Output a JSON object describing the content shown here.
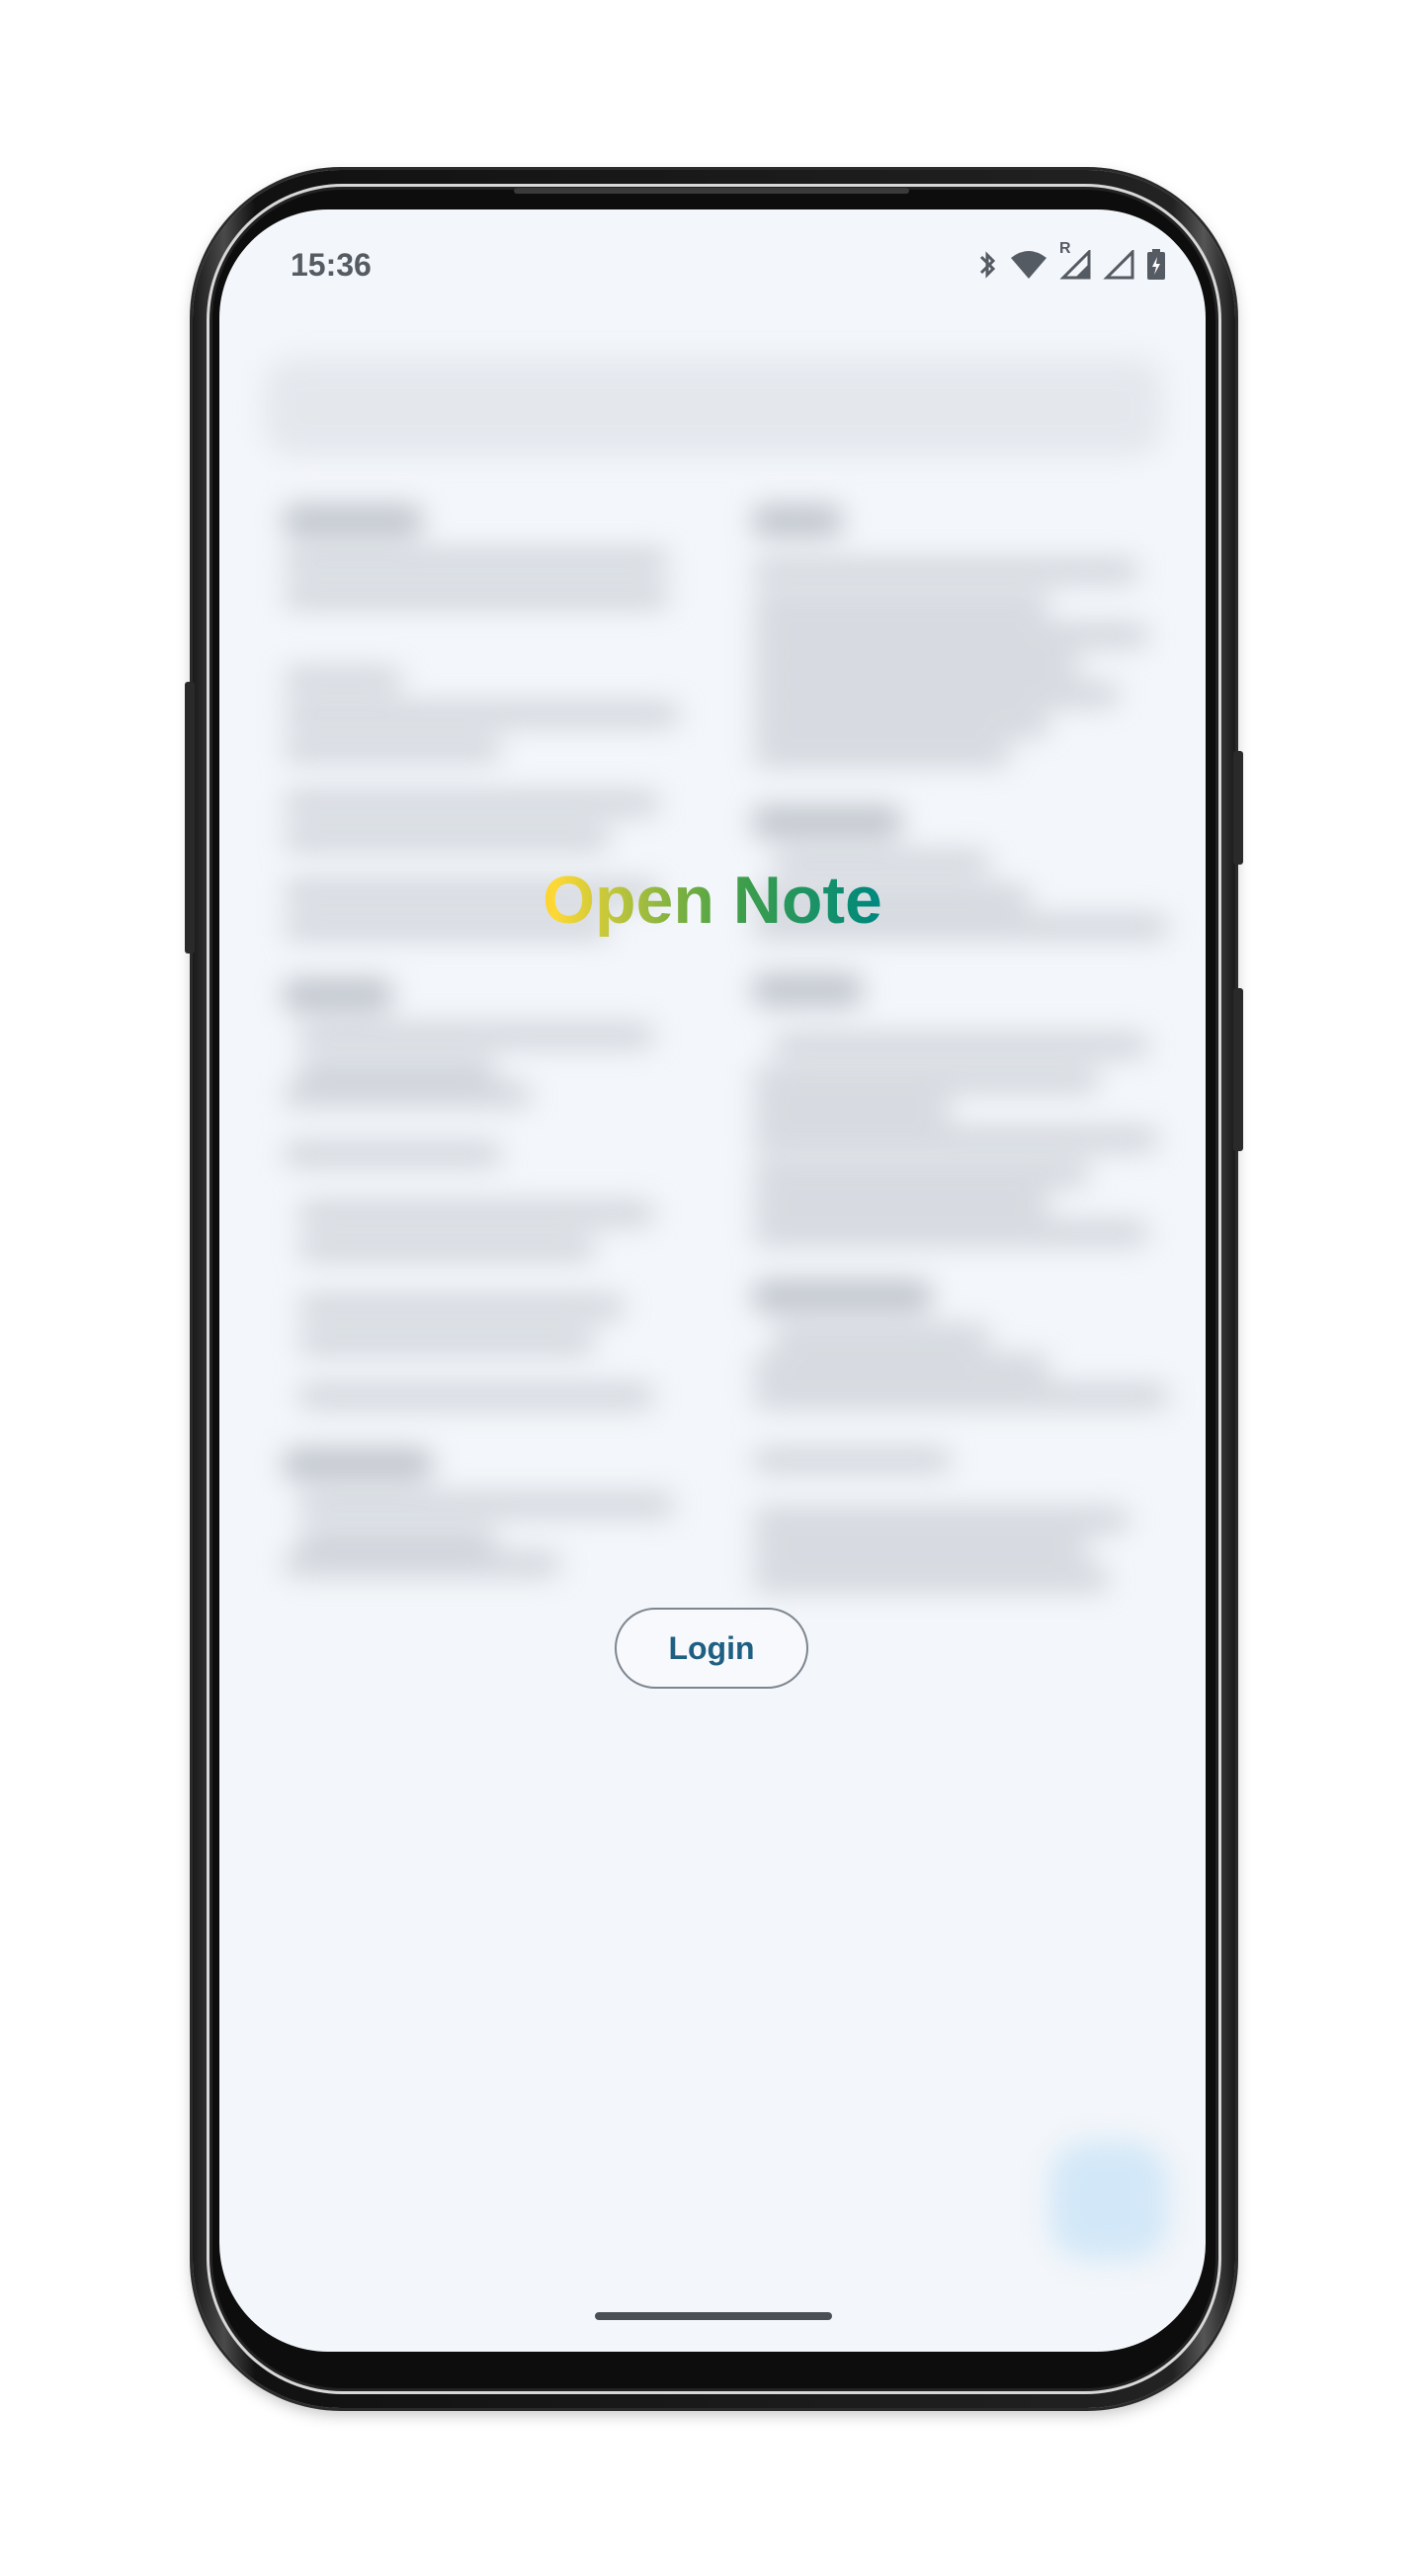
{
  "status_bar": {
    "time": "15:36",
    "icons": [
      "bluetooth-icon",
      "wifi-icon",
      "signal-roaming-icon",
      "signal-icon",
      "battery-charging-icon"
    ],
    "roaming_label": "R"
  },
  "app": {
    "title": "Open Note",
    "title_gradient": [
      "#e53935",
      "#fb8c00",
      "#fdd835",
      "#43a047",
      "#00897b",
      "#1e88e5",
      "#5e35b1"
    ]
  },
  "login": {
    "label": "Login",
    "color": "#1f5f82"
  },
  "colors": {
    "screen_background": "#f3f6fa",
    "fab": "#b8dcf6"
  }
}
